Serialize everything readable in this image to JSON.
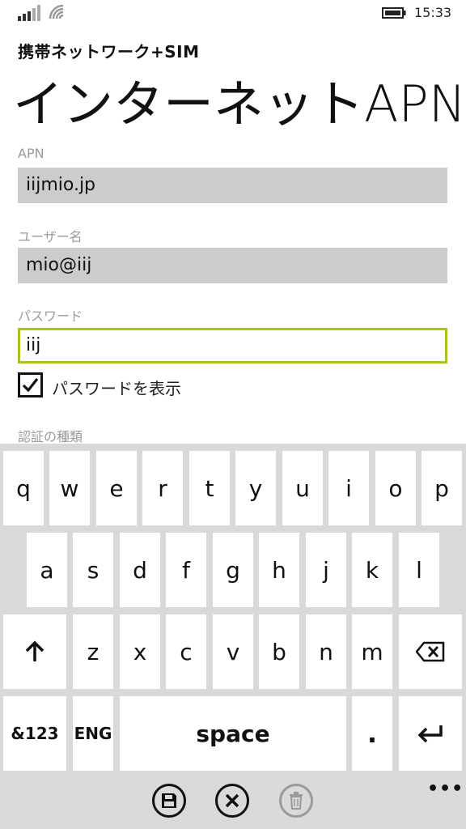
{
  "status": {
    "time": "15:33",
    "icons": [
      "signal-icon",
      "wifi-icon",
      "battery-icon"
    ]
  },
  "header": {
    "section": "携帯ネットワーク+SIM",
    "title": "インターネットAPN"
  },
  "form": {
    "apn": {
      "label": "APN",
      "value": "iijmio.jp"
    },
    "username": {
      "label": "ユーザー名",
      "value": "mio@iij"
    },
    "password": {
      "label": "パスワード",
      "value": "iij"
    },
    "show_password": {
      "label": "パスワードを表示",
      "checked": true
    },
    "auth_type": {
      "label": "認証の種類"
    }
  },
  "keyboard": {
    "row1": [
      "q",
      "w",
      "e",
      "r",
      "t",
      "y",
      "u",
      "i",
      "o",
      "p"
    ],
    "row2": [
      "a",
      "s",
      "d",
      "f",
      "g",
      "h",
      "j",
      "k",
      "l"
    ],
    "row3": [
      "z",
      "x",
      "c",
      "v",
      "b",
      "n",
      "m"
    ],
    "shift": "shift-icon",
    "backspace": "backspace-icon",
    "numbers": "&123",
    "language": "ENG",
    "space": "space",
    "period": ".",
    "enter": "enter-icon"
  },
  "appbar": {
    "buttons": [
      {
        "icon": "save-icon",
        "enabled": true
      },
      {
        "icon": "cancel-icon",
        "enabled": true
      },
      {
        "icon": "delete-icon",
        "enabled": false
      }
    ],
    "more": "•••"
  },
  "colors": {
    "accent": "#a3c51c",
    "field_bg": "#cccccc",
    "keyboard_bg": "#d9d9d9",
    "appbar_bg": "#dadada"
  }
}
